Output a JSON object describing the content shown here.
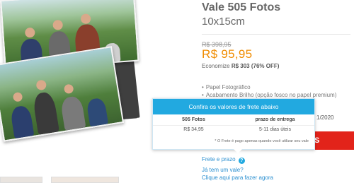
{
  "product": {
    "title": "Vale 505 Fotos",
    "subtitle": "10x15cm",
    "old_price": "R$ 398,95",
    "price": "R$ 95,95",
    "economize_label": "Economize",
    "economize_value": "R$ 303 (76% OFF)",
    "features": [
      "Papel Fotográfico",
      "Acabamento Brilho (opção fosco no papel premium)"
    ]
  },
  "partial": {
    "date_fragment": "1/2020",
    "buy_fragment": "S"
  },
  "freight_tooltip": {
    "header": "Confira os valores de frete abaixo",
    "columns": [
      "505 Fotos",
      "prazo de entrega"
    ],
    "row": [
      "R$ 34,95",
      "5-11 dias úteis"
    ],
    "note": "* O Frete é pago apenas quando você utilizar seu vale"
  },
  "links": {
    "frete": "Frete e prazo",
    "vale_question": "Já tem um vale?",
    "use_vale": "Clique aqui para fazer agora"
  },
  "icons": {
    "help": "question-icon"
  },
  "colors": {
    "price": "#f08c00",
    "tooltip_header": "#22a9e0",
    "link": "#2a8fd0",
    "buy_button": "#e2231a"
  }
}
